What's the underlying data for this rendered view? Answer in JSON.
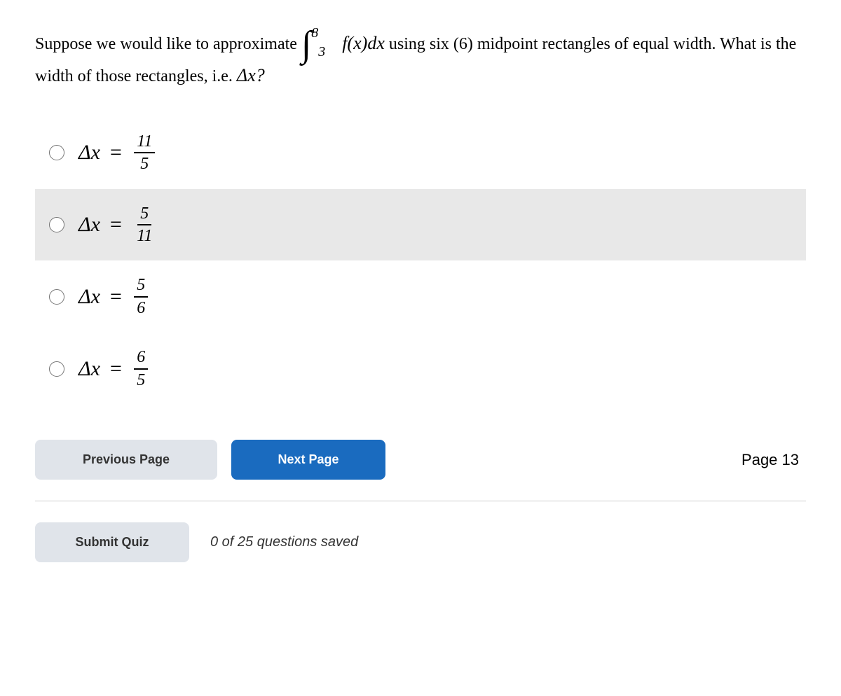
{
  "question": {
    "text_before": "Suppose we would like to approximate",
    "integral_lower": "3",
    "integral_upper": "8",
    "integral_body": "f(x)dx",
    "text_middle": "using six (6) midpoint rectangles of equal width. What is the width of those rectangles, i.e.",
    "delta_symbol": "Δx?"
  },
  "options": [
    {
      "id": "opt1",
      "label": "Δx = 11/5",
      "numerator": "11",
      "denominator": "5",
      "highlighted": false
    },
    {
      "id": "opt2",
      "label": "Δx = 5/11",
      "numerator": "5",
      "denominator": "11",
      "highlighted": true
    },
    {
      "id": "opt3",
      "label": "Δx = 5/6",
      "numerator": "5",
      "denominator": "6",
      "highlighted": false
    },
    {
      "id": "opt4",
      "label": "Δx = 6/5",
      "numerator": "6",
      "denominator": "5",
      "highlighted": false
    }
  ],
  "buttons": {
    "previous_label": "Previous Page",
    "next_label": "Next Page",
    "submit_label": "Submit Quiz",
    "page_text": "Page 13",
    "saved_text": "0 of 25 questions saved"
  }
}
